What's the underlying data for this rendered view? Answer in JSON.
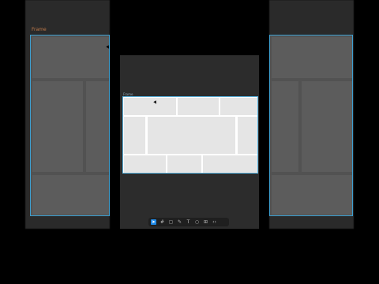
{
  "colors": {
    "accent": "#1e88e5",
    "frame_border": "#5ab4e0",
    "cell_fill": "#e5e5e5",
    "canvas": "#2c2c2c",
    "background": "#000000"
  },
  "canvas": {
    "frame_label": "Frame"
  },
  "background_copy": {
    "frame_label": "Frame"
  },
  "toolbar": {
    "tools": [
      {
        "icon": "move-icon",
        "active": true
      },
      {
        "icon": "frame-icon",
        "active": false
      },
      {
        "icon": "shape-icon",
        "active": false
      },
      {
        "icon": "pen-icon",
        "active": false
      },
      {
        "icon": "text-icon",
        "active": false
      },
      {
        "icon": "comment-icon",
        "active": false
      },
      {
        "icon": "components-icon",
        "active": false
      },
      {
        "icon": "code-icon",
        "active": false
      }
    ]
  }
}
